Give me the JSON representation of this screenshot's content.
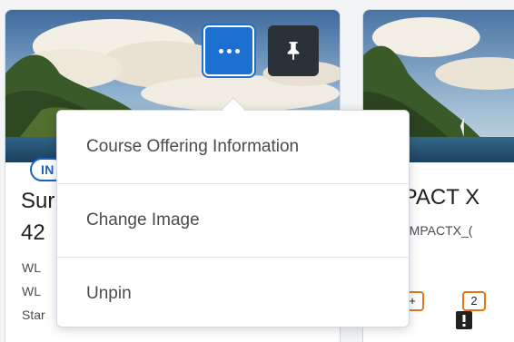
{
  "cards": {
    "left": {
      "status": "IN",
      "title_line1": "Sur",
      "title_line2": "42",
      "meta": [
        "WL",
        "WL",
        "Star"
      ]
    },
    "right": {
      "title": "IPACT X",
      "code": "_IMPACTX_(",
      "notifications": [
        "+",
        "2"
      ]
    }
  },
  "actions": {
    "more_icon": "ellipsis-icon",
    "pin_icon": "pin-icon"
  },
  "menu": {
    "items": [
      {
        "label": "Course Offering Information"
      },
      {
        "label": "Change Image"
      },
      {
        "label": "Unpin"
      }
    ]
  },
  "colors": {
    "accent": "#1d6fd1",
    "pin_button": "#2a3238",
    "badge": "#1764c5",
    "notification": "#e87511"
  }
}
